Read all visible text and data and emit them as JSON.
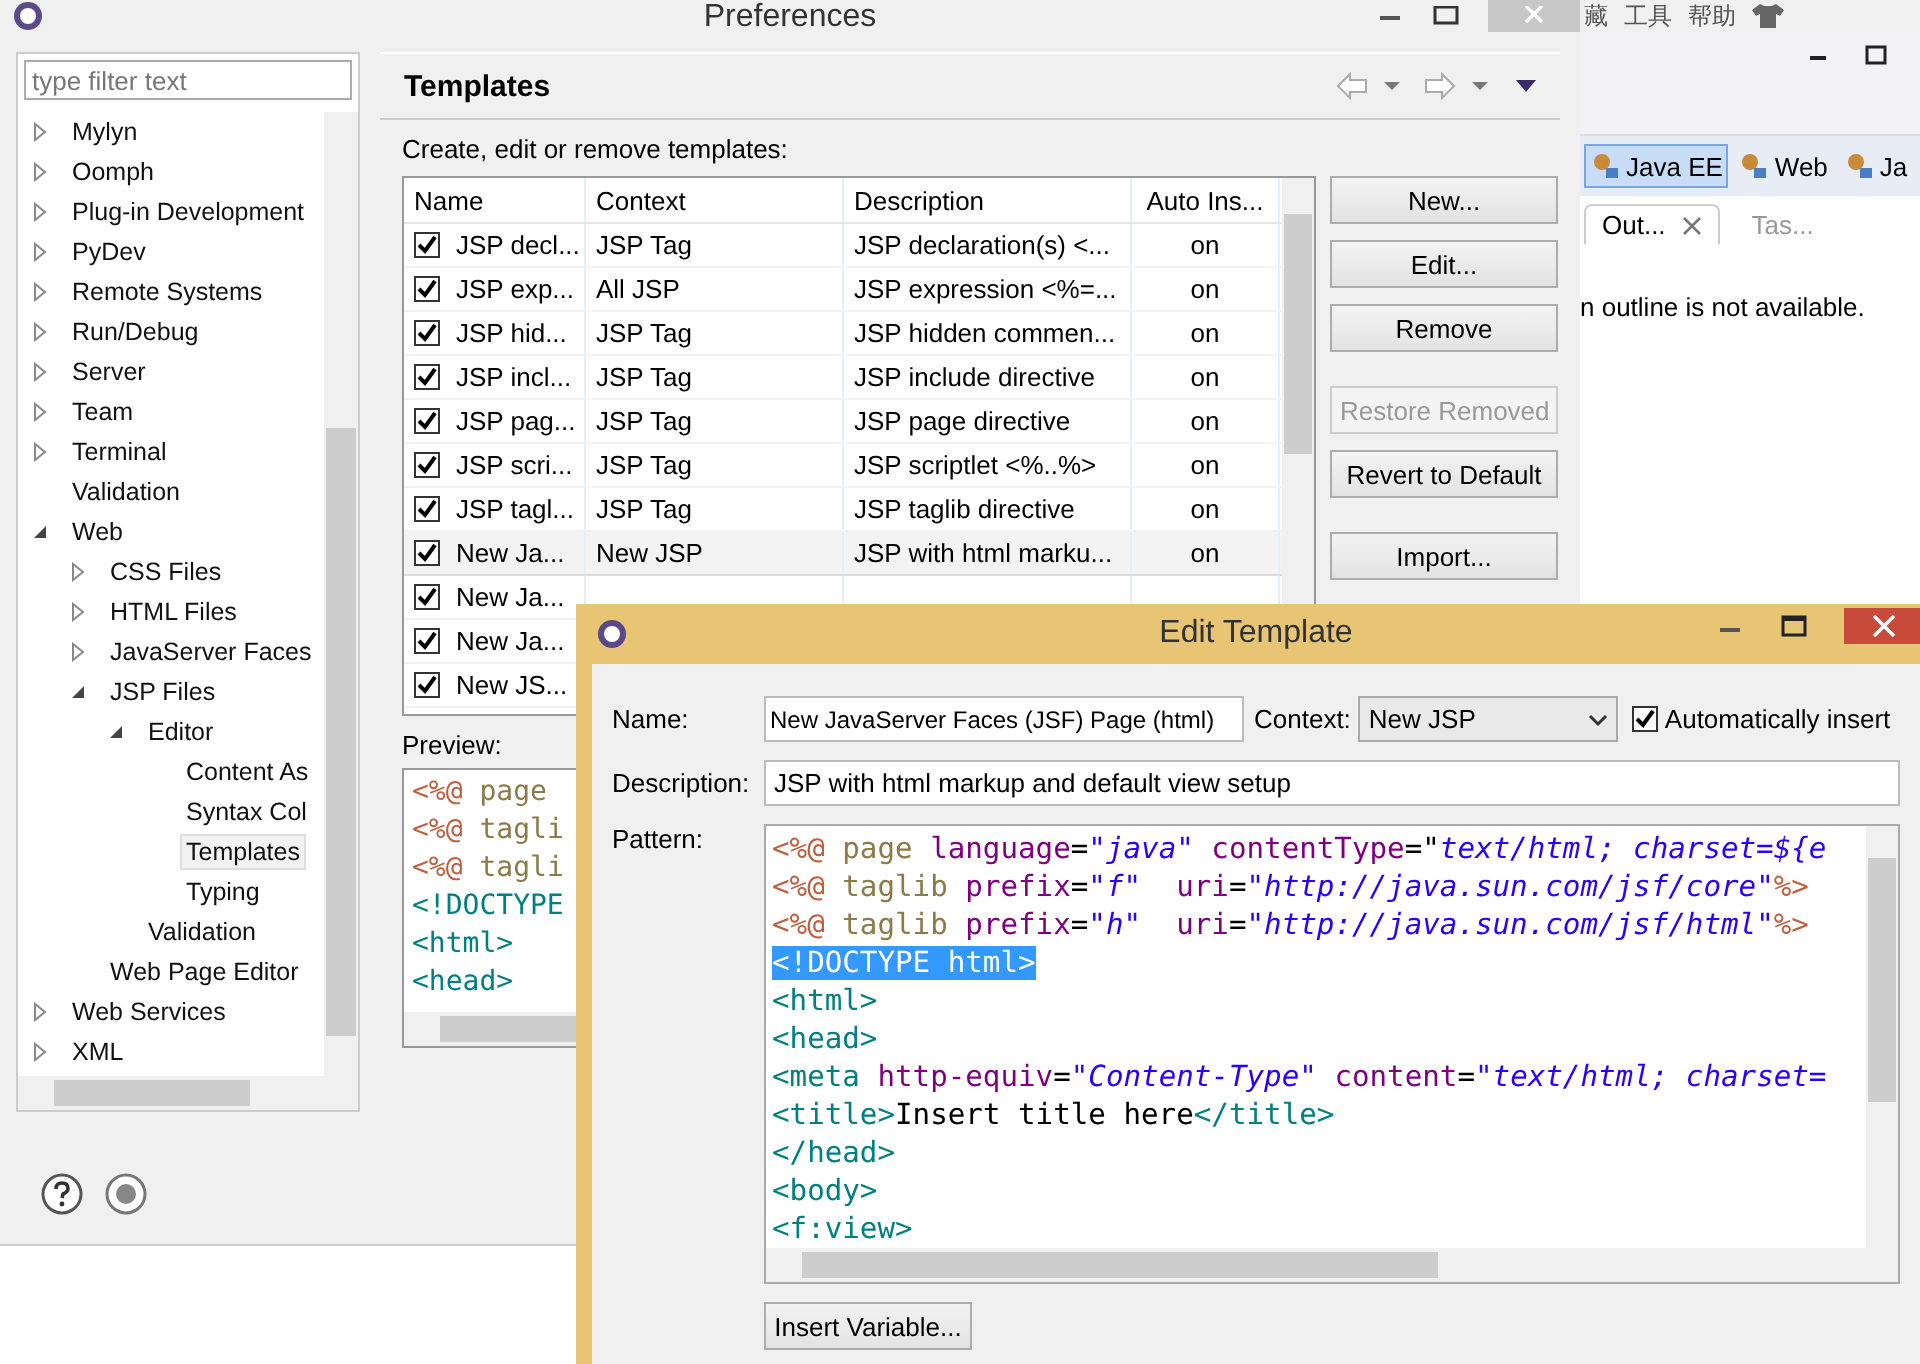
{
  "background_window": {
    "menu": [
      "藏",
      "工具",
      "帮助"
    ],
    "perspectives": [
      {
        "label": "Java EE",
        "selected": true
      },
      {
        "label": "Web",
        "selected": false
      },
      {
        "label": "Ja",
        "selected": false
      }
    ],
    "tabs": [
      {
        "label": "Out...",
        "selected": true,
        "closable": true
      },
      {
        "label": "Tas...",
        "selected": false,
        "closable": false
      }
    ],
    "message": "n outline is not available."
  },
  "preferences": {
    "title": "Preferences",
    "filter": {
      "placeholder": "type filter text"
    },
    "tree": [
      {
        "label": "Mylyn",
        "expanded": false
      },
      {
        "label": "Oomph",
        "expanded": false
      },
      {
        "label": "Plug-in Development",
        "expanded": false
      },
      {
        "label": "PyDev",
        "expanded": false
      },
      {
        "label": "Remote Systems",
        "expanded": false
      },
      {
        "label": "Run/Debug",
        "expanded": false
      },
      {
        "label": "Server",
        "expanded": false
      },
      {
        "label": "Team",
        "expanded": false
      },
      {
        "label": "Terminal",
        "expanded": false
      },
      {
        "label": "Validation"
      },
      {
        "label": "Web",
        "expanded": true,
        "children": [
          {
            "label": "CSS Files",
            "expanded": false
          },
          {
            "label": "HTML Files",
            "expanded": false
          },
          {
            "label": "JavaServer Faces",
            "expanded": false
          },
          {
            "label": "JSP Files",
            "expanded": true,
            "children": [
              {
                "label": "Editor",
                "expanded": true,
                "children": [
                  {
                    "label": "Content As",
                    "selected": false
                  },
                  {
                    "label": "Syntax Col",
                    "selected": false
                  },
                  {
                    "label": "Templates",
                    "selected": true
                  },
                  {
                    "label": "Typing",
                    "selected": false
                  }
                ]
              },
              {
                "label": "Validation"
              }
            ]
          },
          {
            "label": "Web Page Editor"
          }
        ]
      },
      {
        "label": "Web Services",
        "expanded": false
      },
      {
        "label": "XML",
        "expanded": false
      }
    ],
    "page_title": "Templates",
    "intro": "Create, edit or remove templates:",
    "table": {
      "columns": [
        "Name",
        "Context",
        "Description",
        "Auto Ins..."
      ],
      "rows": [
        {
          "checked": true,
          "selected": false,
          "cells": [
            "JSP decl...",
            "JSP Tag",
            "JSP declaration(s) <...",
            "on"
          ]
        },
        {
          "checked": true,
          "selected": false,
          "cells": [
            "JSP exp...",
            "All JSP",
            "JSP expression <%=...",
            "on"
          ]
        },
        {
          "checked": true,
          "selected": false,
          "cells": [
            "JSP hid...",
            "JSP Tag",
            "JSP hidden commen...",
            "on"
          ]
        },
        {
          "checked": true,
          "selected": false,
          "cells": [
            "JSP incl...",
            "JSP Tag",
            "JSP include directive",
            "on"
          ]
        },
        {
          "checked": true,
          "selected": false,
          "cells": [
            "JSP pag...",
            "JSP Tag",
            "JSP page directive",
            "on"
          ]
        },
        {
          "checked": true,
          "selected": false,
          "cells": [
            "JSP scri...",
            "JSP Tag",
            "JSP scriptlet <%..%>",
            "on"
          ]
        },
        {
          "checked": true,
          "selected": false,
          "cells": [
            "JSP tagl...",
            "JSP Tag",
            "JSP taglib directive",
            "on"
          ]
        },
        {
          "checked": true,
          "selected": true,
          "cells": [
            "New Ja...",
            "New JSP",
            "JSP with html marku...",
            "on"
          ]
        },
        {
          "checked": true,
          "selected": false,
          "cells": [
            "New Ja..."
          ]
        },
        {
          "checked": true,
          "selected": false,
          "cells": [
            "New Ja..."
          ]
        },
        {
          "checked": true,
          "selected": false,
          "cells": [
            "New JS..."
          ]
        }
      ]
    },
    "buttons": [
      {
        "label": "New...",
        "disabled": false
      },
      {
        "label": "Edit...",
        "disabled": false
      },
      {
        "label": "Remove",
        "disabled": false
      },
      {
        "label": "Restore Removed",
        "disabled": true
      },
      {
        "label": "Revert to Default",
        "disabled": false
      },
      {
        "label": "Import...",
        "disabled": false
      }
    ],
    "preview_label": "Preview:",
    "preview": [
      [
        {
          "kind": "directive",
          "text": "<%@"
        },
        {
          "kind": "keyword",
          "text": " page"
        }
      ],
      [
        {
          "kind": "directive",
          "text": "<%@"
        },
        {
          "kind": "keyword",
          "text": " tagli"
        }
      ],
      [
        {
          "kind": "directive",
          "text": "<%@"
        },
        {
          "kind": "keyword",
          "text": " tagli"
        }
      ],
      [
        {
          "kind": "tag",
          "text": "<!DOCTYPE"
        }
      ],
      [
        {
          "kind": "tag",
          "text": "<html>"
        }
      ],
      [
        {
          "kind": "tag",
          "text": "<head>"
        }
      ]
    ]
  },
  "edit_template": {
    "title": "Edit Template",
    "name_label": "Name:",
    "name": "New JavaServer Faces (JSF) Page (html)",
    "context_label": "Context:",
    "context": "New JSP",
    "auto_insert": {
      "label": "Automatically insert",
      "checked": true
    },
    "description_label": "Description:",
    "description": "JSP with html markup and default view setup",
    "pattern_label": "Pattern:",
    "pattern": [
      [
        {
          "kind": "directive",
          "text": "<%@"
        },
        {
          "kind": "keyword",
          "text": " page "
        },
        {
          "kind": "attr",
          "text": "language"
        },
        {
          "kind": "plain",
          "text": "="
        },
        {
          "kind": "value",
          "text": "\"java\""
        },
        {
          "kind": "attr",
          "text": " contentType"
        },
        {
          "kind": "plain",
          "text": "=\""
        },
        {
          "kind": "value",
          "text": "text/html; charset=${e"
        }
      ],
      [
        {
          "kind": "directive",
          "text": "<%@"
        },
        {
          "kind": "keyword",
          "text": " taglib "
        },
        {
          "kind": "attr",
          "text": "prefix"
        },
        {
          "kind": "plain",
          "text": "="
        },
        {
          "kind": "value",
          "text": "\"f\""
        },
        {
          "kind": "attr",
          "text": "  uri"
        },
        {
          "kind": "plain",
          "text": "="
        },
        {
          "kind": "value",
          "text": "\"http://java.sun.com/jsf/core\""
        },
        {
          "kind": "directive",
          "text": "%>"
        }
      ],
      [
        {
          "kind": "directive",
          "text": "<%@"
        },
        {
          "kind": "keyword",
          "text": " taglib "
        },
        {
          "kind": "attr",
          "text": "prefix"
        },
        {
          "kind": "plain",
          "text": "="
        },
        {
          "kind": "value",
          "text": "\"h\""
        },
        {
          "kind": "attr",
          "text": "  uri"
        },
        {
          "kind": "plain",
          "text": "="
        },
        {
          "kind": "value",
          "text": "\"http://java.sun.com/jsf/html\""
        },
        {
          "kind": "directive",
          "text": "%>"
        }
      ],
      [
        {
          "kind": "selection",
          "text": "<!DOCTYPE html>"
        }
      ],
      [
        {
          "kind": "tag",
          "text": "<html>"
        }
      ],
      [
        {
          "kind": "tag",
          "text": "<head>"
        }
      ],
      [
        {
          "kind": "tag",
          "text": "<meta "
        },
        {
          "kind": "attr",
          "text": "http-equiv"
        },
        {
          "kind": "plain",
          "text": "="
        },
        {
          "kind": "value",
          "text": "\"Content-Type\""
        },
        {
          "kind": "attr",
          "text": " content"
        },
        {
          "kind": "plain",
          "text": "="
        },
        {
          "kind": "value",
          "text": "\"text/html; charset="
        }
      ],
      [
        {
          "kind": "tag",
          "text": "<title>"
        },
        {
          "kind": "plain",
          "text": "Insert title here"
        },
        {
          "kind": "tag",
          "text": "</title>"
        }
      ],
      [
        {
          "kind": "tag",
          "text": "</head>"
        }
      ],
      [
        {
          "kind": "tag",
          "text": "<body>"
        }
      ],
      [
        {
          "kind": "tag",
          "text": "<f:view>"
        }
      ]
    ],
    "insert_button": "Insert Variable..."
  }
}
